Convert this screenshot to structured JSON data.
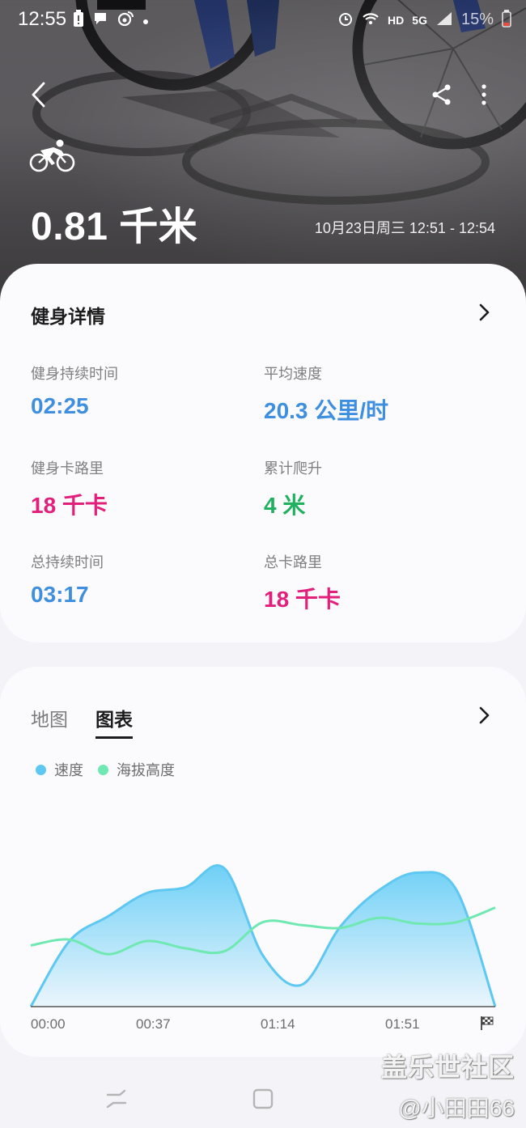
{
  "status_bar": {
    "time": "12:55",
    "network_hd": "HD",
    "network_5g": "5G",
    "battery": "15%"
  },
  "header": {
    "distance": "0.81 千米",
    "datetime": "10月23日周三 12:51 - 12:54"
  },
  "details": {
    "title": "健身详情",
    "stats": [
      {
        "label": "健身持续时间",
        "value": "02:25",
        "color": "#3f8fe0"
      },
      {
        "label": "平均速度",
        "value": "20.3 公里/时",
        "color": "#3f8fe0"
      },
      {
        "label": "健身卡路里",
        "value": "18 千卡",
        "color": "#e2207c"
      },
      {
        "label": "累计爬升",
        "value": "4 米",
        "color": "#20b15f"
      },
      {
        "label": "总持续时间",
        "value": "03:17",
        "color": "#3f8fe0"
      },
      {
        "label": "总卡路里",
        "value": "18 千卡",
        "color": "#e2207c"
      }
    ]
  },
  "chart_section": {
    "tabs": [
      "地图",
      "图表"
    ],
    "active_tab": "图表"
  },
  "chart_data": {
    "type": "area",
    "x": [
      "00:00",
      "00:15",
      "00:30",
      "00:45",
      "01:00",
      "01:10",
      "01:20",
      "01:30",
      "01:40",
      "01:50",
      "02:00",
      "02:10",
      "02:17"
    ],
    "x_ticks": [
      "00:00",
      "00:37",
      "01:14",
      "01:51"
    ],
    "series": [
      {
        "name": "速度",
        "color": "#5ec8f2",
        "values": [
          0,
          45,
          62,
          78,
          82,
          95,
          35,
          15,
          55,
          80,
          92,
          80,
          0
        ]
      },
      {
        "name": "海拔高度",
        "color": "#6fe8b2",
        "values": [
          42,
          46,
          36,
          45,
          40,
          38,
          58,
          56,
          54,
          61,
          57,
          58,
          68
        ]
      }
    ],
    "ylim": [
      0,
      100
    ],
    "grid": false
  },
  "watermark": {
    "line1": "盖乐世社区",
    "line2": "@小田田66"
  }
}
